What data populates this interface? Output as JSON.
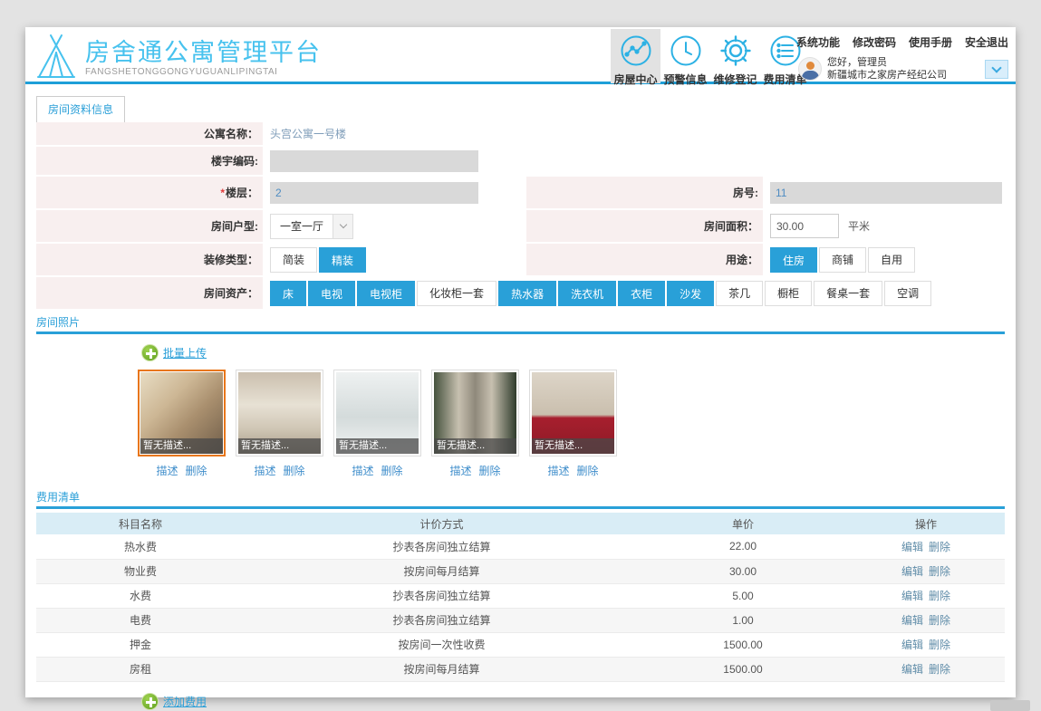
{
  "header": {
    "logo": {
      "title": "房舍通公寓管理平台",
      "subtitle": "FANGSHETONGGONGYUGUANLIPINGTAI"
    },
    "nav": [
      {
        "label": "房屋中心",
        "icon": "chart-circle-icon",
        "active": true
      },
      {
        "label": "预警信息",
        "icon": "clock-icon",
        "active": false
      },
      {
        "label": "维修登记",
        "icon": "gear-icon",
        "active": false
      },
      {
        "label": "费用清单",
        "icon": "list-circle-icon",
        "active": false
      }
    ],
    "links": [
      "系统功能",
      "修改密码",
      "使用手册",
      "安全退出"
    ],
    "user": {
      "greeting": "您好，管理员",
      "company": "新疆城市之家房产经纪公司"
    }
  },
  "tab": {
    "label": "房间资料信息"
  },
  "form": {
    "apartment_name": {
      "label": "公寓名称：",
      "value": "头宫公寓一号楼"
    },
    "building_code": {
      "label": "楼宇编码:",
      "value": ""
    },
    "floor": {
      "required": "*",
      "label": "楼层：",
      "value": "2"
    },
    "room_no": {
      "label": "房号:",
      "value": "11"
    },
    "room_type": {
      "label": "房间户型:",
      "value": "一室一厅"
    },
    "room_area": {
      "label": "房间面积：",
      "value": "30.00",
      "unit": "平米"
    },
    "decoration": {
      "label": "装修类型：",
      "options": [
        {
          "label": "简装",
          "selected": false
        },
        {
          "label": "精装",
          "selected": true
        }
      ]
    },
    "usage": {
      "label": "用途：",
      "options": [
        {
          "label": "住房",
          "selected": true
        },
        {
          "label": "商铺",
          "selected": false
        },
        {
          "label": "自用",
          "selected": false
        }
      ]
    },
    "assets": {
      "label": "房间资产：",
      "options": [
        {
          "label": "床",
          "selected": true
        },
        {
          "label": "电视",
          "selected": true
        },
        {
          "label": "电视柜",
          "selected": true
        },
        {
          "label": "化妆柜一套",
          "selected": false
        },
        {
          "label": "热水器",
          "selected": true
        },
        {
          "label": "洗衣机",
          "selected": true
        },
        {
          "label": "衣柜",
          "selected": true
        },
        {
          "label": "沙发",
          "selected": true
        },
        {
          "label": "茶几",
          "selected": false
        },
        {
          "label": "橱柜",
          "selected": false
        },
        {
          "label": "餐桌一套",
          "selected": false
        },
        {
          "label": "空调",
          "selected": false
        }
      ]
    }
  },
  "photos": {
    "section_title": "房间照片",
    "upload_label": "批量上传",
    "desc_label": "描述",
    "delete_label": "删除",
    "items": [
      {
        "caption": "暂无描述...",
        "kind": "living-room",
        "selected": true
      },
      {
        "caption": "暂无描述...",
        "kind": "empty-room",
        "selected": false
      },
      {
        "caption": "暂无描述...",
        "kind": "bathroom",
        "selected": false
      },
      {
        "caption": "暂无描述...",
        "kind": "corridor",
        "selected": false
      },
      {
        "caption": "暂无描述...",
        "kind": "kitchen",
        "selected": false
      }
    ]
  },
  "fees": {
    "section_title": "费用清单",
    "add_label": "添加费用",
    "table": {
      "headers": [
        "科目名称",
        "计价方式",
        "单价",
        "操作"
      ],
      "edit_label": "编辑",
      "delete_label": "删除",
      "rows": [
        {
          "name": "热水费",
          "method": "抄表各房间独立结算",
          "price": "22.00"
        },
        {
          "name": "物业费",
          "method": "按房间每月结算",
          "price": "30.00"
        },
        {
          "name": "水费",
          "method": "抄表各房间独立结算",
          "price": "5.00"
        },
        {
          "name": "电费",
          "method": "抄表各房间独立结算",
          "price": "1.00"
        },
        {
          "name": "押金",
          "method": "按房间一次性收费",
          "price": "1500.00"
        },
        {
          "name": "房租",
          "method": "按房间每月结算",
          "price": "1500.00"
        }
      ]
    }
  },
  "colors": {
    "accent_blue": "#29a0d8",
    "header_underline": "#1e9fd8",
    "logo_blue": "#47c2ee",
    "form_label_bg": "#f8efef",
    "disabled_input_bg": "#d9d9d9",
    "table_header_bg": "#d9edf6",
    "selected_photo_border": "#e8761a",
    "upload_green": "#6cb52d"
  }
}
